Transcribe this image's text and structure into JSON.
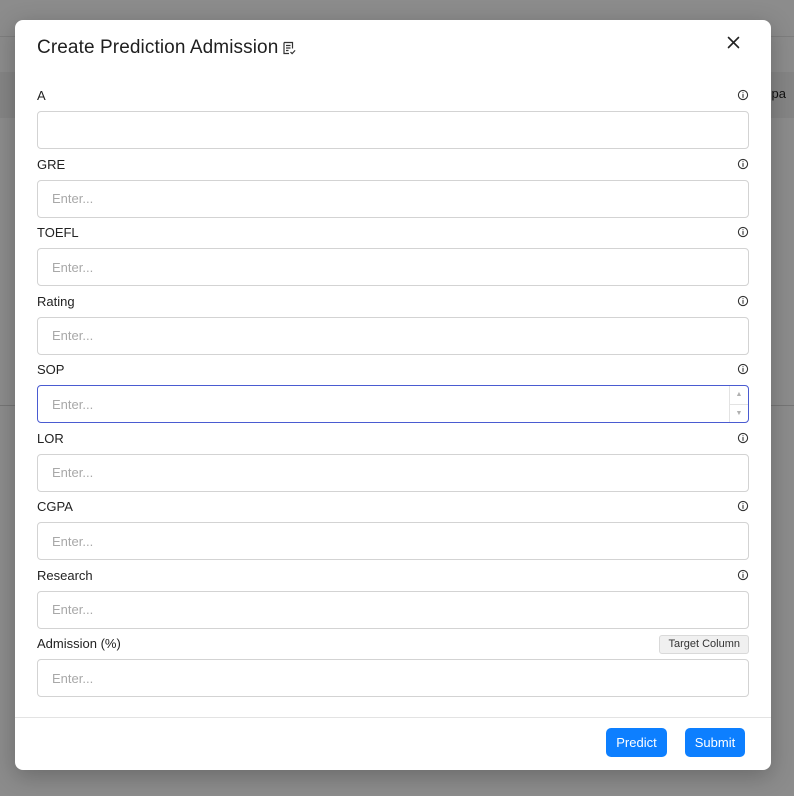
{
  "background": {
    "partial_text": "pa"
  },
  "modal": {
    "title": "Create Prediction Admission",
    "title_icon": "document-check-icon",
    "close_icon": "close-icon"
  },
  "fields": [
    {
      "label": "A",
      "value": "",
      "placeholder": "",
      "info_icon": "info-icon"
    },
    {
      "label": "GRE",
      "value": "",
      "placeholder": "Enter...",
      "info_icon": "info-icon"
    },
    {
      "label": "TOEFL",
      "value": "",
      "placeholder": "Enter...",
      "info_icon": "info-icon"
    },
    {
      "label": "Rating",
      "value": "",
      "placeholder": "Enter...",
      "info_icon": "info-icon"
    },
    {
      "label": "SOP",
      "value": "",
      "placeholder": "Enter...",
      "info_icon": "info-icon",
      "focused": true
    },
    {
      "label": "LOR",
      "value": "",
      "placeholder": "Enter...",
      "info_icon": "info-icon"
    },
    {
      "label": "CGPA",
      "value": "",
      "placeholder": "Enter...",
      "info_icon": "info-icon"
    },
    {
      "label": "Research",
      "value": "",
      "placeholder": "Enter...",
      "info_icon": "info-icon"
    },
    {
      "label": "Admission (%)",
      "value": "",
      "placeholder": "Enter...",
      "badge": "Target Column"
    }
  ],
  "footer": {
    "predict_label": "Predict",
    "submit_label": "Submit"
  },
  "colors": {
    "primary": "#0d7fff",
    "focus_border": "#4a5bd1"
  }
}
